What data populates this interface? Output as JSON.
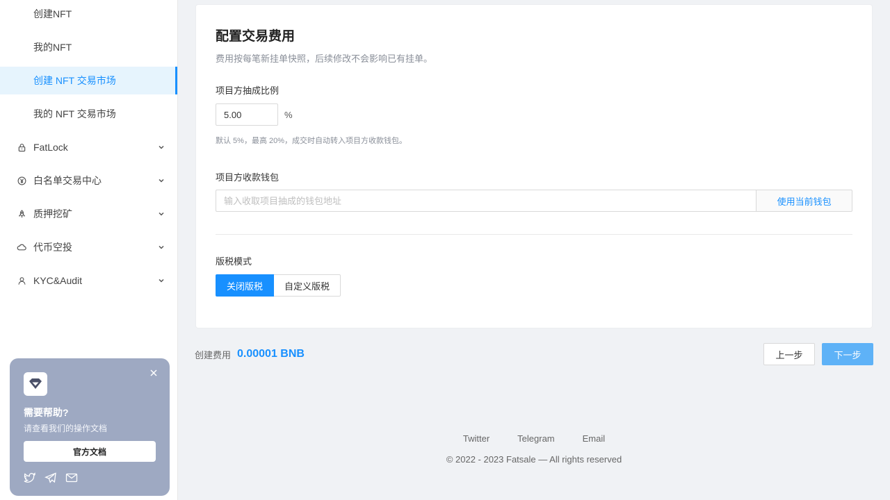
{
  "sidebar": {
    "sub_items": [
      {
        "label": "创建NFT"
      },
      {
        "label": "我的NFT"
      },
      {
        "label": "创建 NFT 交易市场"
      },
      {
        "label": "我的 NFT 交易市场"
      }
    ],
    "groups": [
      {
        "label": "FatLock",
        "icon": "lock-icon"
      },
      {
        "label": "白名单交易中心",
        "icon": "yen-circle-icon"
      },
      {
        "label": "质押挖矿",
        "icon": "rocket-icon"
      },
      {
        "label": "代币空投",
        "icon": "cloud-icon"
      },
      {
        "label": "KYC&Audit",
        "icon": "user-icon"
      }
    ]
  },
  "help": {
    "title": "需要帮助?",
    "subtitle": "请查看我们的操作文档",
    "button": "官方文档"
  },
  "card": {
    "title": "配置交易费用",
    "description": "费用按每笔新挂单快照，后续修改不会影响已有挂单。",
    "project_fee_label": "项目方抽成比例",
    "project_fee_value": "5.00",
    "project_fee_unit": "%",
    "project_fee_hint": "默认 5%，最高 20%，成交时自动转入项目方收款钱包。",
    "wallet_label": "项目方收款钱包",
    "wallet_placeholder": "输入收取项目抽成的钱包地址",
    "wallet_button": "使用当前钱包",
    "royalty_label": "版税模式",
    "royalty_options": [
      "关闭版税",
      "自定义版税"
    ],
    "royalty_selected": "关闭版税"
  },
  "footer_bar": {
    "fee_label": "创建费用",
    "fee_value": "0.00001 BNB",
    "prev": "上一步",
    "next": "下一步"
  },
  "footer": {
    "links": [
      "Twitter",
      "Telegram",
      "Email"
    ],
    "copyright": "© 2022 - 2023 Fatsale — All rights reserved"
  },
  "colors": {
    "accent": "#1890ff",
    "active_bg": "#e6f4fd",
    "help_card_bg": "#9ea9c2",
    "next_button": "#5eb2f7"
  }
}
